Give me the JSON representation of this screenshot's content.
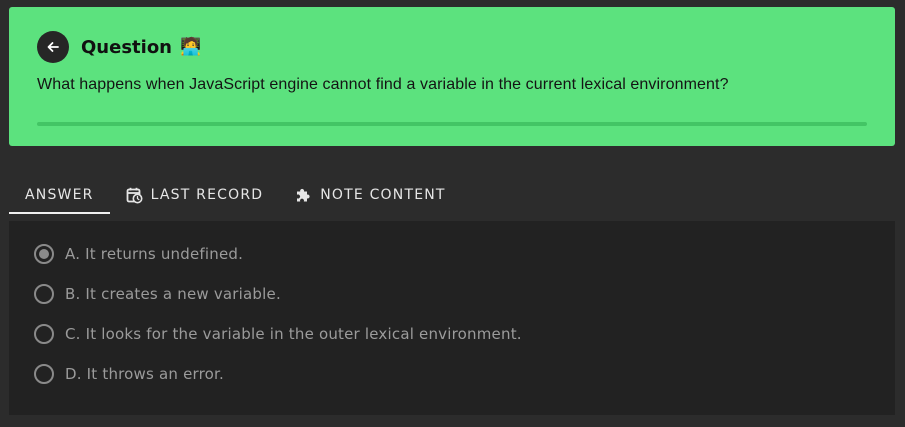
{
  "question": {
    "title": "Question",
    "emoji": "🧑‍💻",
    "text": "What happens when JavaScript engine cannot find a variable in the current lexical environment?"
  },
  "tabs": [
    {
      "label": "ANSWER",
      "icon": "none",
      "active": true
    },
    {
      "label": "LAST RECORD",
      "icon": "calendar-clock-icon",
      "active": false
    },
    {
      "label": "NOTE CONTENT",
      "icon": "puzzle-icon",
      "active": false
    }
  ],
  "options": [
    {
      "label": "A. It returns undefined.",
      "selected": true
    },
    {
      "label": "B. It creates a new variable.",
      "selected": false
    },
    {
      "label": "C. It looks for the variable in the outer lexical environment.",
      "selected": false
    },
    {
      "label": "D. It throws an error.",
      "selected": false
    }
  ],
  "colors": {
    "card_green": "#5ce27e",
    "page_bg": "#2c2c2c",
    "panel_bg": "#222222"
  }
}
